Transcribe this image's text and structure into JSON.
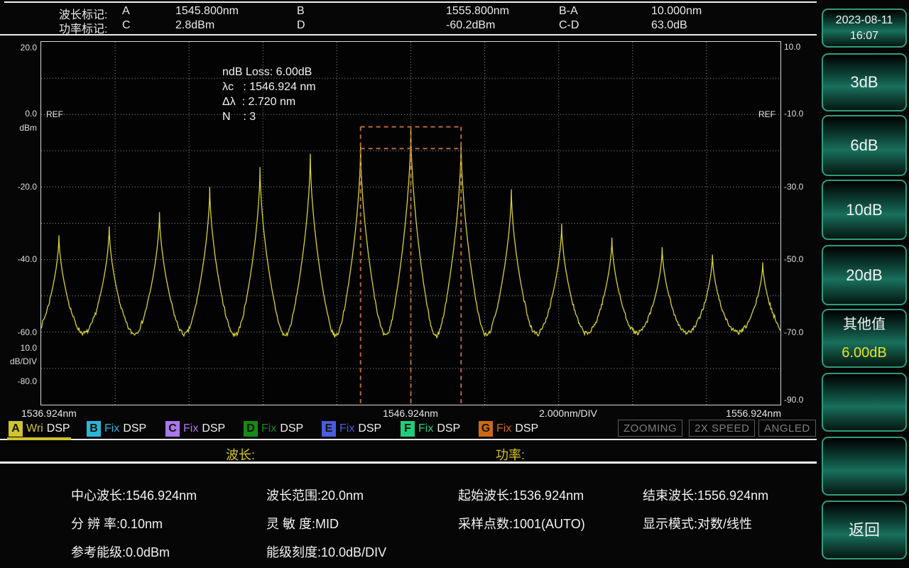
{
  "header": {
    "wavelength_row": {
      "label": "波长标记:",
      "marker1": "A",
      "value1": "1545.800nm",
      "marker2": "B",
      "value2": "1555.800nm",
      "diff_label": "B-A",
      "diff_value": "10.000nm"
    },
    "power_row": {
      "label": "功率标记:",
      "marker1": "C",
      "value1": "2.8dBm",
      "marker2": "D",
      "value2": "-60.2dBm",
      "diff_label": "C-D",
      "diff_value": "63.0dB"
    }
  },
  "chart_data": {
    "type": "line",
    "x_unit": "nm",
    "y_unit": "dBm",
    "x_range": [
      1536.924,
      1556.924
    ],
    "y_axis_left": {
      "range": [
        20.0,
        -80.0
      ],
      "ticks": [
        "20.0",
        "0.0",
        "-20.0",
        "-40.0",
        "-60.0",
        "-80.0"
      ],
      "unit": "dBm",
      "scale_value": "10.0",
      "scale_unit": "dB/DIV"
    },
    "y_axis_right": {
      "range": [
        10.0,
        -90.0
      ],
      "ticks": [
        "10.0",
        "-10.0",
        "-30.0",
        "-50.0",
        "-70.0",
        "-90.0"
      ]
    },
    "x_labels": {
      "start": "1536.924nm",
      "center": "1546.924nm",
      "div": "2.000nm/DIV",
      "end": "1556.924nm"
    },
    "grid": {
      "x_div_nm": 2.0,
      "y_div_db": 10.0,
      "style": "dotted"
    },
    "ref_label": "REF",
    "ref_level_dbm": 0.0,
    "trace_color": "#d6d332",
    "noise_floor_dbm": -64.0,
    "sample_points": 1001,
    "peaks": [
      {
        "nm": 1537.404,
        "dbm": -33.3
      },
      {
        "nm": 1538.764,
        "dbm": -30.9
      },
      {
        "nm": 1540.124,
        "dbm": -27.0
      },
      {
        "nm": 1541.484,
        "dbm": -20.0
      },
      {
        "nm": 1542.844,
        "dbm": -14.5
      },
      {
        "nm": 1544.204,
        "dbm": -10.9
      },
      {
        "nm": 1545.564,
        "dbm": -8.8
      },
      {
        "nm": 1546.924,
        "dbm": -3.5
      },
      {
        "nm": 1548.284,
        "dbm": -7.6
      },
      {
        "nm": 1549.644,
        "dbm": -20.6
      },
      {
        "nm": 1551.004,
        "dbm": -30.2
      },
      {
        "nm": 1552.364,
        "dbm": -34.0
      },
      {
        "nm": 1553.724,
        "dbm": -36.7
      },
      {
        "nm": 1555.084,
        "dbm": -38.7
      },
      {
        "nm": 1556.444,
        "dbm": -40.8
      }
    ],
    "ndb_analysis": {
      "lines": [
        "ndB Loss: 6.00dB",
        "λc   : 1546.924 nm",
        "Δλ  : 2.720 nm",
        "N    : 3"
      ],
      "box": {
        "left_nm": 1545.564,
        "right_nm": 1548.284,
        "top_dbm": -3.4,
        "down_dbm": -9.4
      },
      "color": "#b56a35"
    }
  },
  "legend": {
    "traces": [
      {
        "letter": "A",
        "mode": "Wri",
        "kind": "DSP",
        "color": "#cfc32f",
        "active": true
      },
      {
        "letter": "B",
        "mode": "Fix",
        "kind": "DSP",
        "color": "#2ab5d9",
        "active": false
      },
      {
        "letter": "C",
        "mode": "Fix",
        "kind": "DSP",
        "color": "#a878ec",
        "active": false
      },
      {
        "letter": "D",
        "mode": "Fix",
        "kind": "DSP",
        "color": "#168a16",
        "active": false
      },
      {
        "letter": "E",
        "mode": "Fix",
        "kind": "DSP",
        "color": "#4a5ce0",
        "active": false
      },
      {
        "letter": "F",
        "mode": "Fix",
        "kind": "DSP",
        "color": "#23cc7a",
        "active": false
      },
      {
        "letter": "G",
        "mode": "Fix",
        "kind": "DSP",
        "color": "#cc6a14",
        "active": false
      }
    ],
    "status": [
      "ZOOMING",
      "2X SPEED",
      "ANGLED"
    ]
  },
  "section_labels": {
    "wavelength": "波长:",
    "power": "功率:"
  },
  "info": {
    "rows": [
      [
        {
          "label": "中心波长:",
          "value": "1546.924nm"
        },
        {
          "label": "波长范围:",
          "value": "20.0nm"
        },
        {
          "label": "起始波长:",
          "value": "1536.924nm"
        },
        {
          "label": "结束波长:",
          "value": "1556.924nm"
        }
      ],
      [
        {
          "label": "分 辨 率:",
          "value": "0.10nm"
        },
        {
          "label": "灵 敏 度:",
          "value": "MID"
        },
        {
          "label": "采样点数:",
          "value": "1001(AUTO)"
        },
        {
          "label": "显示模式:",
          "value": "对数/线性"
        }
      ],
      [
        {
          "label": "参考能级:",
          "value": "0.0dBm"
        },
        {
          "label": "能级刻度:",
          "value": "10.0dB/DIV"
        },
        null,
        null
      ]
    ]
  },
  "sidebar": {
    "buttons": [
      {
        "name": "datetime",
        "lines": [
          "2023-08-11",
          "16:07"
        ],
        "highlight_line2": false
      },
      {
        "name": "3db",
        "lines": [
          "3dB"
        ],
        "highlight_line2": false
      },
      {
        "name": "6db",
        "lines": [
          "6dB"
        ],
        "highlight_line2": false
      },
      {
        "name": "10db",
        "lines": [
          "10dB"
        ],
        "highlight_line2": false
      },
      {
        "name": "20db",
        "lines": [
          "20dB"
        ],
        "highlight_line2": false
      },
      {
        "name": "other-value",
        "lines": [
          "其他值",
          "6.00dB"
        ],
        "highlight_line2": true
      },
      {
        "name": "blank-1",
        "lines": [],
        "highlight_line2": false
      },
      {
        "name": "blank-2",
        "lines": [],
        "highlight_line2": false
      },
      {
        "name": "back",
        "lines": [
          "返回"
        ],
        "highlight_line2": false
      }
    ]
  }
}
